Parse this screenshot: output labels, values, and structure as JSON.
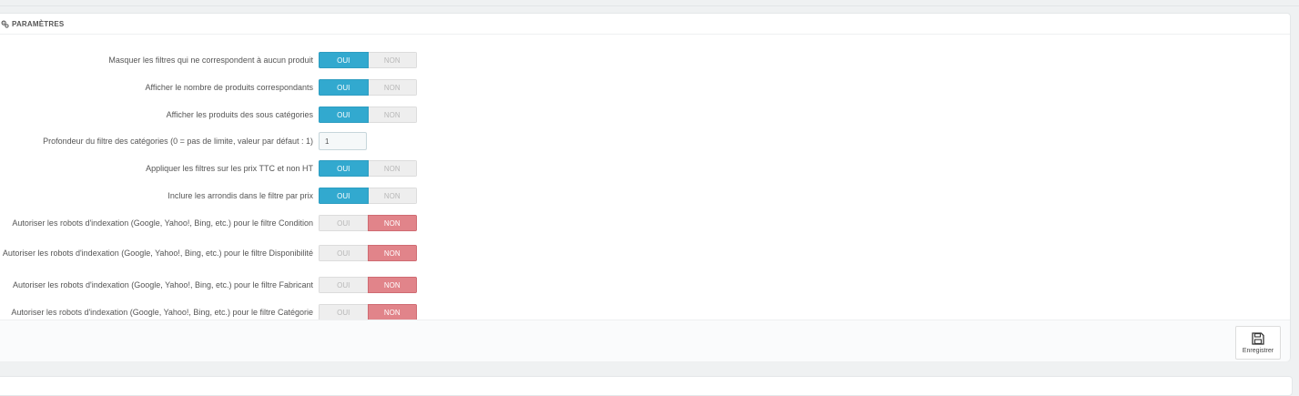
{
  "panel": {
    "title": "PARAMÈTRES",
    "icon": "cogs-icon"
  },
  "settings": [
    {
      "label": "Masquer les filtres qui ne correspondent à aucun produit",
      "type": "switch",
      "value": "OUI"
    },
    {
      "label": "Afficher le nombre de produits correspondants",
      "type": "switch",
      "value": "OUI"
    },
    {
      "label": "Afficher les produits des sous catégories",
      "type": "switch",
      "value": "OUI"
    },
    {
      "label": "Profondeur du filtre des catégories (0 = pas de limite, valeur par défaut : 1)",
      "type": "input",
      "value": "1"
    },
    {
      "label": "Appliquer les filtres sur les prix TTC et non HT",
      "type": "switch",
      "value": "OUI"
    },
    {
      "label": "Inclure les arrondis dans le filtre par prix",
      "type": "switch",
      "value": "OUI"
    },
    {
      "label": "Autoriser les robots d'indexation (Google, Yahoo!, Bing, etc.) pour le filtre Condition",
      "type": "switch",
      "value": "NON"
    },
    {
      "label": "Autoriser les robots d'indexation (Google, Yahoo!, Bing, etc.) pour le filtre Disponibilité",
      "type": "switch",
      "value": "NON"
    },
    {
      "label": "Autoriser les robots d'indexation (Google, Yahoo!, Bing, etc.) pour le filtre Fabricant",
      "type": "switch",
      "value": "NON"
    },
    {
      "label": "Autoriser les robots d'indexation (Google, Yahoo!, Bing, etc.) pour le filtre Catégorie",
      "type": "switch",
      "value": "NON"
    }
  ],
  "switch_labels": {
    "yes": "OUI",
    "no": "NON"
  },
  "footer": {
    "save_label": "Enregistrer",
    "save_icon": "floppy-disk-icon"
  },
  "colors": {
    "yes_active": "#32a9cf",
    "no_active": "#e1848a",
    "inactive": "#eeeeee"
  }
}
